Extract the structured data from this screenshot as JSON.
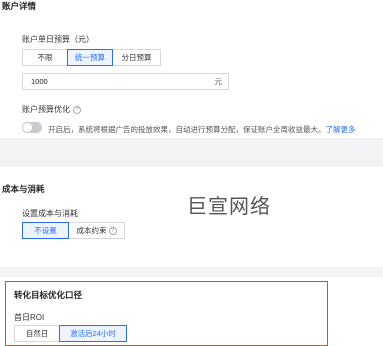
{
  "account": {
    "title": "账户详情",
    "daily_budget_label": "账户单日预算（元）",
    "budget_options": [
      "不限",
      "统一预算",
      "分日预算"
    ],
    "budget_active_index": 1,
    "budget_value": "1000",
    "budget_unit": "元",
    "optimize_label": "账户预算优化",
    "optimize_enabled": false,
    "optimize_desc": "开启后，系统将根据广告的投放效果，自动进行预算分配，保证账户全周收益最大。",
    "learn_more": "了解更多"
  },
  "cost": {
    "title": "成本与消耗",
    "setting_label": "设置成本与消耗",
    "options": [
      "不设置",
      "成本约束"
    ],
    "active_index": 0
  },
  "watermark": "巨宣网络",
  "conversion": {
    "title": "转化目标优化口径",
    "roi_label": "首日ROI",
    "options": [
      "自然日",
      "激活后24小时"
    ],
    "active_index": 1
  }
}
